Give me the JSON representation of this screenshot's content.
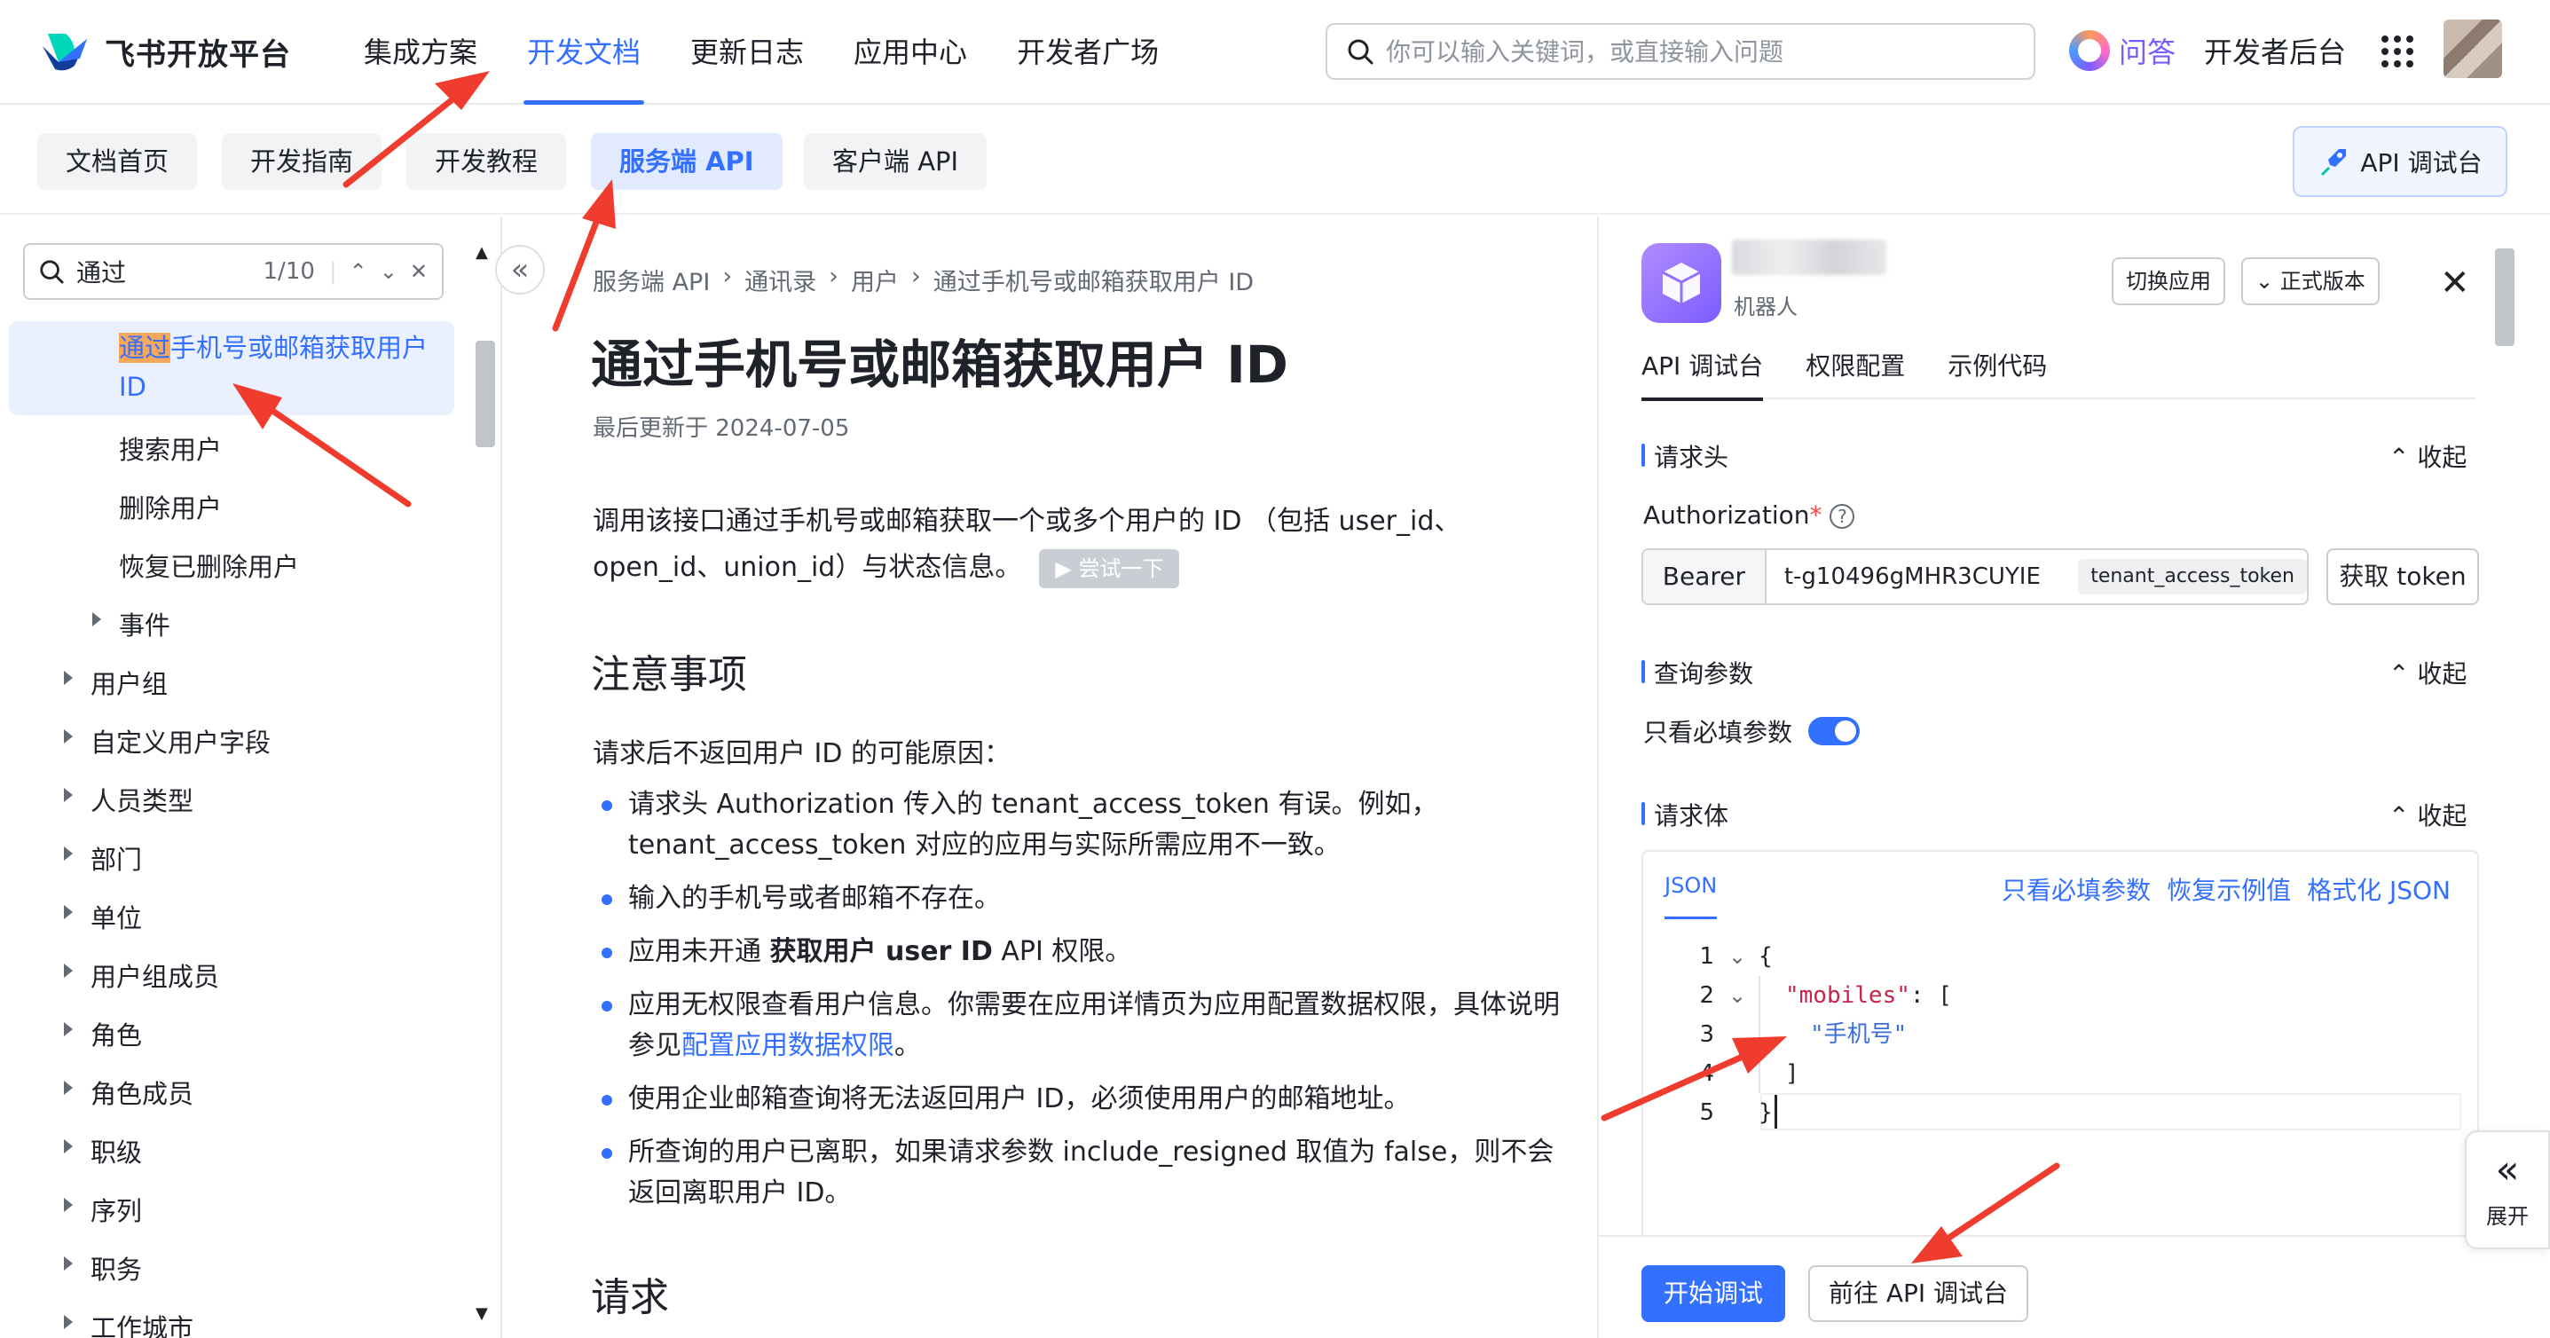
{
  "brand": {
    "name": "飞书开放平台"
  },
  "topnav": {
    "items": [
      {
        "label": "集成方案",
        "active": false
      },
      {
        "label": "开发文档",
        "active": true
      },
      {
        "label": "更新日志",
        "active": false
      },
      {
        "label": "应用中心",
        "active": false
      },
      {
        "label": "开发者广场",
        "active": false
      }
    ],
    "search_placeholder": "你可以输入关键词，或直接输入问题",
    "qa_label": "问答",
    "dev_console_label": "开发者后台"
  },
  "subnav": {
    "tabs": [
      {
        "label": "文档首页"
      },
      {
        "label": "开发指南"
      },
      {
        "label": "开发教程"
      },
      {
        "label": "服务端 API",
        "active": true
      },
      {
        "label": "客户端 API"
      }
    ],
    "api_console_label": "API 调试台"
  },
  "sidebar": {
    "search_query": "通过",
    "match_count": "1/10",
    "items": [
      {
        "label_hl": "通过",
        "label_rest": "手机号或邮箱获取用户",
        "label_line2": "ID",
        "active": true
      },
      {
        "label": "搜索用户"
      },
      {
        "label": "删除用户"
      },
      {
        "label": "恢复已删除用户"
      },
      {
        "label": "事件",
        "expandable": true
      },
      {
        "label": "用户组",
        "expandable": true
      },
      {
        "label": "自定义用户字段",
        "expandable": true
      },
      {
        "label": "人员类型",
        "expandable": true
      },
      {
        "label": "部门",
        "expandable": true
      },
      {
        "label": "单位",
        "expandable": true
      },
      {
        "label": "用户组成员",
        "expandable": true
      },
      {
        "label": "角色",
        "expandable": true
      },
      {
        "label": "角色成员",
        "expandable": true
      },
      {
        "label": "职级",
        "expandable": true
      },
      {
        "label": "序列",
        "expandable": true
      },
      {
        "label": "职务",
        "expandable": true
      },
      {
        "label": "工作城市",
        "expandable": true
      }
    ]
  },
  "doc": {
    "breadcrumb": [
      "服务端 API",
      "通讯录",
      "用户",
      "通过手机号或邮箱获取用户 ID"
    ],
    "title": "通过手机号或邮箱获取用户 ID",
    "updated": "最后更新于 2024-07-05",
    "intro_line1": "调用该接口通过手机号或邮箱获取一个或多个用户的 ID （包括 user_id、",
    "intro_line2": "open_id、union_id）与状态信息。",
    "try_label": "▶ 尝试一下",
    "notes_heading": "注意事项",
    "reasons_intro": "请求后不返回用户 ID 的可能原因：",
    "bullets": [
      {
        "text": "请求头 Authorization 传入的 tenant_access_token 有误。例如，tenant_access_token 对应的应用与实际所需应用不一致。"
      },
      {
        "text": "输入的手机号或者邮箱不存在。"
      },
      {
        "pre": "应用未开通 ",
        "bold": "获取用户 user ID",
        "post": " API 权限。"
      },
      {
        "pre": "应用无权限查看用户信息。你需要在应用详情页为应用配置数据权限，具体说明参见",
        "link": "配置应用数据权限",
        "post": "。"
      },
      {
        "text": "使用企业邮箱查询将无法返回用户 ID，必须使用用户的邮箱地址。"
      },
      {
        "text": "所查询的用户已离职，如果请求参数 include_resigned 取值为 false，则不会返回离职用户 ID。"
      }
    ],
    "request_heading": "请求"
  },
  "console": {
    "app_role": "机器人",
    "switch_app": "切换应用",
    "version": "正式版本",
    "tabs": [
      {
        "label": "API 调试台",
        "active": true
      },
      {
        "label": "权限配置"
      },
      {
        "label": "示例代码"
      }
    ],
    "fold_label": "收起",
    "header_section": "请求头",
    "auth_label": "Authorization",
    "bearer": "Bearer",
    "token_value": "t-g10496gMHR3CUYIE",
    "token_type": "tenant_access_token",
    "get_token": "获取 token",
    "query_section": "查询参数",
    "only_required": "只看必填参数",
    "body_section": "请求体",
    "editor_tab": "JSON",
    "editor_actions": [
      "只看必填参数",
      "恢复示例值",
      "格式化 JSON"
    ],
    "code_lines": [
      {
        "n": "1",
        "text": "{"
      },
      {
        "n": "2",
        "key": "\"mobiles\"",
        "text": ": ["
      },
      {
        "n": "3",
        "str": "\"手机号\""
      },
      {
        "n": "4",
        "text": "]"
      },
      {
        "n": "5",
        "text": "}"
      }
    ],
    "run": "开始调试",
    "goto_console": "前往 API 调试台"
  },
  "expand_label": "展开",
  "colors": {
    "accent": "#3370ff",
    "annotation_arrow": "#f03c2e"
  }
}
